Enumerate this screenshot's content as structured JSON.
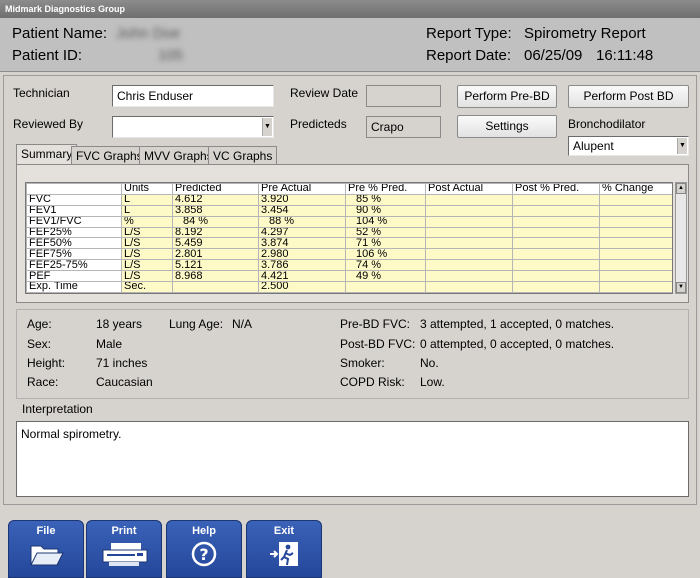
{
  "app": {
    "title": "Midmark Diagnostics Group"
  },
  "header": {
    "patient_name_label": "Patient Name:",
    "patient_name": "John Doe",
    "patient_id_label": "Patient ID:",
    "patient_id": "105",
    "report_type_label": "Report Type:",
    "report_type": "Spirometry Report",
    "report_date_label": "Report Date:",
    "report_date": "06/25/09",
    "report_time": "16:11:48"
  },
  "form": {
    "technician_label": "Technician",
    "technician_value": "Chris Enduser",
    "reviewed_by_label": "Reviewed By",
    "reviewed_by_value": "",
    "review_date_label": "Review Date",
    "review_date_value": "",
    "predicteds_label": "Predicteds",
    "predicteds_value": "Crapo",
    "bronchodilator_label": "Bronchodilator",
    "bronchodilator_value": "Alupent",
    "perform_pre_bd": "Perform Pre-BD",
    "perform_post_bd": "Perform Post BD",
    "settings": "Settings"
  },
  "tabs": [
    "Summary",
    "FVC Graphs",
    "MVV Graphs",
    "VC Graphs"
  ],
  "table": {
    "headers": [
      "",
      "Units",
      "Predicted",
      "Pre Actual",
      "Pre % Pred.",
      "Post Actual",
      "Post % Pred.",
      "% Change"
    ],
    "rows": [
      [
        "FVC",
        "L",
        "4.612",
        "3.920",
        "85 %",
        "",
        "",
        ""
      ],
      [
        "FEV1",
        "L",
        "3.858",
        "3.454",
        "90 %",
        "",
        "",
        ""
      ],
      [
        "FEV1/FVC",
        "%",
        "84 %",
        "88 %",
        "104 %",
        "",
        "",
        ""
      ],
      [
        "FEF25%",
        "L/S",
        "8.192",
        "4.297",
        "52 %",
        "",
        "",
        ""
      ],
      [
        "FEF50%",
        "L/S",
        "5.459",
        "3.874",
        "71 %",
        "",
        "",
        ""
      ],
      [
        "FEF75%",
        "L/S",
        "2.801",
        "2.980",
        "106 %",
        "",
        "",
        ""
      ],
      [
        "FEF25-75%",
        "L/S",
        "5.121",
        "3.786",
        "74 %",
        "",
        "",
        ""
      ],
      [
        "PEF",
        "L/S",
        "8.968",
        "4.421",
        "49 %",
        "",
        "",
        ""
      ],
      [
        "Exp. Time",
        "Sec.",
        "",
        "2.500",
        "",
        "",
        "",
        ""
      ]
    ]
  },
  "patient_info": {
    "age_label": "Age:",
    "age": "18 years",
    "lung_age_label": "Lung Age:",
    "lung_age": "N/A",
    "sex_label": "Sex:",
    "sex": "Male",
    "height_label": "Height:",
    "height": "71 inches",
    "race_label": "Race:",
    "race": "Caucasian",
    "pre_bd_fvc_label": "Pre-BD FVC:",
    "pre_bd_fvc": "3 attempted, 1 accepted, 0 matches.",
    "post_bd_fvc_label": "Post-BD FVC:",
    "post_bd_fvc": "0 attempted, 0 accepted, 0 matches.",
    "smoker_label": "Smoker:",
    "smoker": "No.",
    "copd_label": "COPD Risk:",
    "copd": "Low."
  },
  "interpretation": {
    "label": "Interpretation",
    "text": "Normal spirometry."
  },
  "nav": {
    "file": "File",
    "print": "Print",
    "help": "Help",
    "exit": "Exit"
  },
  "colors": {
    "nav_blue": "#2a4fa3",
    "grid_yellow": "#fefac8"
  }
}
